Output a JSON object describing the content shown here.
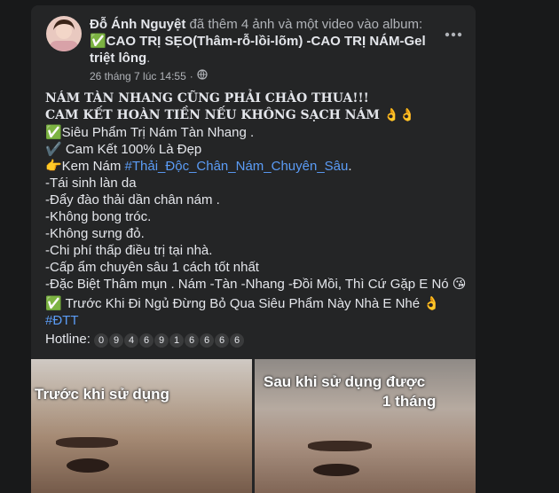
{
  "post": {
    "author": "Đỗ Ánh Nguyệt",
    "action": " đã thêm 4 ảnh và một video vào album:",
    "album_line1": "✅CAO TRỊ SẸO(Thâm-rỗ-lồi-lõm) -CAO TRỊ NÁM-Gel",
    "album_line2": "triệt lông",
    "album_period": ".",
    "timestamp": "26 tháng 7 lúc 14:55",
    "separator": "·",
    "privacy_icon": "globe-icon",
    "more_icon": "more-options-icon"
  },
  "content": {
    "headline1": "NÁM TÀN NHANG CŨNG PHẢI CHÀO THUA!!!",
    "headline2": "CAM KẾT HOÀN TIỀN NẾU KHÔNG SẠCH NÁM 👌👌",
    "l1": "✅Siêu Phẩm Trị Nám Tàn Nhang .",
    "l2": "✔️ Cam Kết 100% Là Đẹp",
    "l3_prefix": "👉Kem Nám ",
    "l3_hashtag": "#Thải_Độc_Chân_Nám_Chuyên_Sâu",
    "l3_suffix": ".",
    "l4": "-Tái sinh làn da",
    "l5": "-Đẩy đào thải dần chân nám .",
    "l6": "-Không bong tróc.",
    "l7": "-Không sưng đỏ.",
    "l8": "-Chi phí thấp điều trị tại nhà.",
    "l9": "-Cấp ẩm chuyên sâu 1 cách tốt nhất",
    "l10": "-Đặc Biệt Thâm mụn . Nám -Tàn -Nhang -Đồi Mồi, Thì Cứ Gặp E Nó 😘",
    "l11": "✅ Trước Khi Đi Ngủ Đừng Bỏ Qua Siêu Phẩm Này Nhà E Nhé 👌",
    "hashtag2": "#ĐTT",
    "hotline_label": "Hotline: ",
    "hotline_digits": [
      "0",
      "9",
      "4",
      "6",
      "9",
      "1",
      "6",
      "6",
      "6",
      "6"
    ]
  },
  "photos": {
    "before_label": "Trước khi sử dụng",
    "after_label_1": "Sau khi sử dụng được",
    "after_label_2": "1 tháng"
  }
}
